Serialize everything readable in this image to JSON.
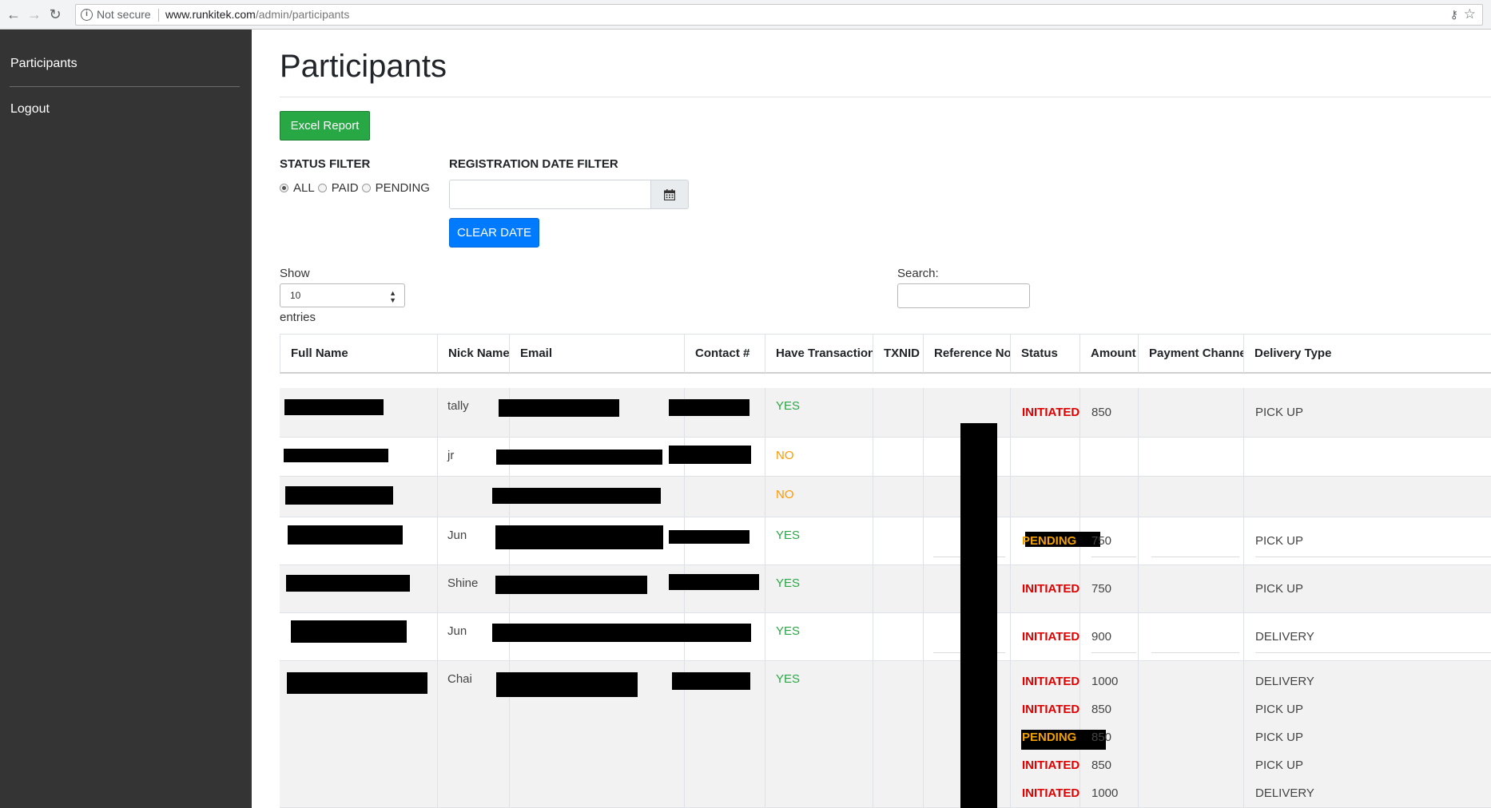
{
  "browser": {
    "security_label": "Not secure",
    "url_host": "www.runkitek.com",
    "url_path": "/admin/participants"
  },
  "sidebar": {
    "items": [
      {
        "label": "Participants"
      },
      {
        "label": "Logout"
      }
    ]
  },
  "page": {
    "title": "Participants",
    "excel_button": "Excel Report",
    "status_filter": {
      "label": "STATUS FILTER",
      "options": [
        "ALL",
        "PAID",
        "PENDING"
      ],
      "selected": "ALL"
    },
    "date_filter": {
      "label": "REGISTRATION DATE FILTER",
      "value": "",
      "clear_button": "CLEAR DATE"
    },
    "length": {
      "show_label": "Show",
      "value": "10",
      "entries_label": "entries"
    },
    "search": {
      "label": "Search:",
      "value": ""
    }
  },
  "table": {
    "columns": [
      "Full Name",
      "Nick Name",
      "Email",
      "Contact #",
      "Have Transaction?",
      "TXNID",
      "Reference No.",
      "Status",
      "Amount",
      "Payment Channel",
      "Delivery Type"
    ],
    "rows": [
      {
        "nick": "tally",
        "transaction": "YES",
        "txns": [
          {
            "status": "INITIATED",
            "amount": "850",
            "channel": "",
            "delivery": "PICK UP"
          }
        ]
      },
      {
        "nick": "jr",
        "transaction": "NO",
        "txns": []
      },
      {
        "nick": "",
        "transaction": "NO",
        "txns": []
      },
      {
        "nick": "Jun",
        "transaction": "YES",
        "txns": [
          {
            "status": "PENDING",
            "amount": "750",
            "channel": "",
            "delivery": "PICK UP"
          }
        ]
      },
      {
        "nick": "Shine",
        "transaction": "YES",
        "txns": [
          {
            "status": "INITIATED",
            "amount": "750",
            "channel": "",
            "delivery": "PICK UP"
          }
        ]
      },
      {
        "nick": "Jun",
        "transaction": "YES",
        "txns": [
          {
            "status": "INITIATED",
            "amount": "900",
            "channel": "",
            "delivery": "DELIVERY"
          }
        ]
      },
      {
        "nick": "Chai",
        "transaction": "YES",
        "txns": [
          {
            "status": "INITIATED",
            "amount": "1000",
            "channel": "",
            "delivery": "DELIVERY"
          },
          {
            "status": "INITIATED",
            "amount": "850",
            "channel": "",
            "delivery": "PICK UP"
          },
          {
            "status": "PENDING",
            "amount": "850",
            "channel": "",
            "delivery": "PICK UP"
          },
          {
            "status": "INITIATED",
            "amount": "850",
            "channel": "",
            "delivery": "PICK UP"
          },
          {
            "status": "INITIATED",
            "amount": "1000",
            "channel": "",
            "delivery": "DELIVERY"
          }
        ]
      }
    ]
  },
  "colors": {
    "sidebar_bg": "#343434",
    "excel_button": "#28a745",
    "clear_button": "#007bff",
    "status_initiated": "#e00000",
    "status_pending": "#f0a000",
    "transaction_yes": "#28a745",
    "transaction_no": "#ff9800"
  }
}
